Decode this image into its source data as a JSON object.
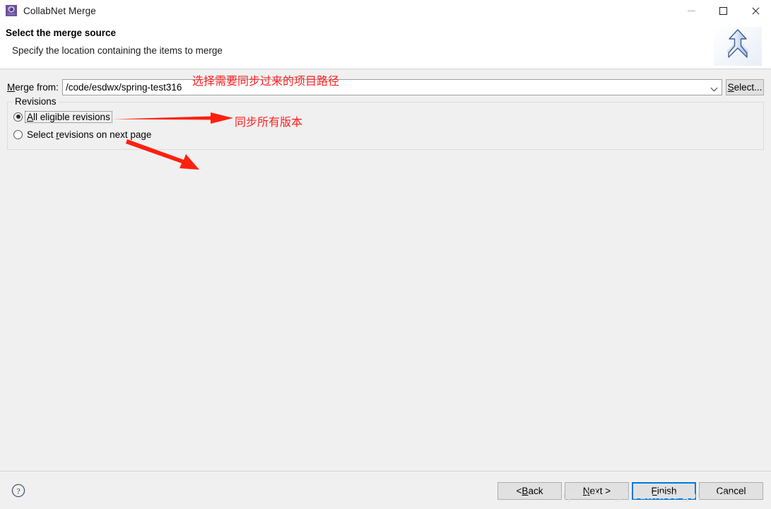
{
  "window": {
    "title": "CollabNet Merge",
    "app_icon": "collabnet-gear-icon",
    "controls": {
      "minimize": "minimize-icon",
      "maximize": "maximize-icon",
      "close": "close-icon"
    }
  },
  "header": {
    "title": "Select the merge source",
    "description": "Specify the location containing the items to merge",
    "banner_icon": "merge-arrow-icon"
  },
  "form": {
    "merge_from_label_prefix": "M",
    "merge_from_label_rest": "erge from:",
    "merge_from_value": "/code/esdwx/spring-test316",
    "merge_from_placeholder": "",
    "dropdown_icon": "chevron-down-icon",
    "select_button_prefix": "S",
    "select_button_rest": "elect..."
  },
  "revisions": {
    "group_title": "Revisions",
    "options": [
      {
        "label_prefix": "A",
        "label_rest": "ll eligible revisions",
        "selected": true,
        "focused": true
      },
      {
        "label_prefix": "Select ",
        "label_mnem": "r",
        "label_rest": "evisions on next page",
        "selected": false,
        "focused": false
      }
    ]
  },
  "annotations": {
    "accent_color": "#ff2020",
    "items": [
      {
        "text": "选择需要同步过来的项目路径",
        "kind": "text"
      },
      {
        "text": "同步所有版本",
        "kind": "text"
      },
      {
        "text": "",
        "kind": "arrow-horizontal"
      },
      {
        "text": "",
        "kind": "arrow-diagonal"
      }
    ]
  },
  "footer": {
    "help_icon": "help-question-icon",
    "buttons": [
      {
        "name": "back",
        "prefix": "< ",
        "mnem": "B",
        "rest": "ack",
        "default": false,
        "enabled": true
      },
      {
        "name": "next",
        "prefix": "",
        "mnem": "N",
        "rest": "ext >",
        "default": false,
        "enabled": true
      },
      {
        "name": "finish",
        "prefix": "",
        "mnem": "F",
        "rest": "inish",
        "default": true,
        "enabled": true
      },
      {
        "name": "cancel",
        "prefix": "",
        "mnem": "",
        "rest": "Cancel",
        "default": false,
        "enabled": true
      }
    ]
  },
  "watermark": {
    "text": "https://blog.csdn.net/goubrian"
  }
}
